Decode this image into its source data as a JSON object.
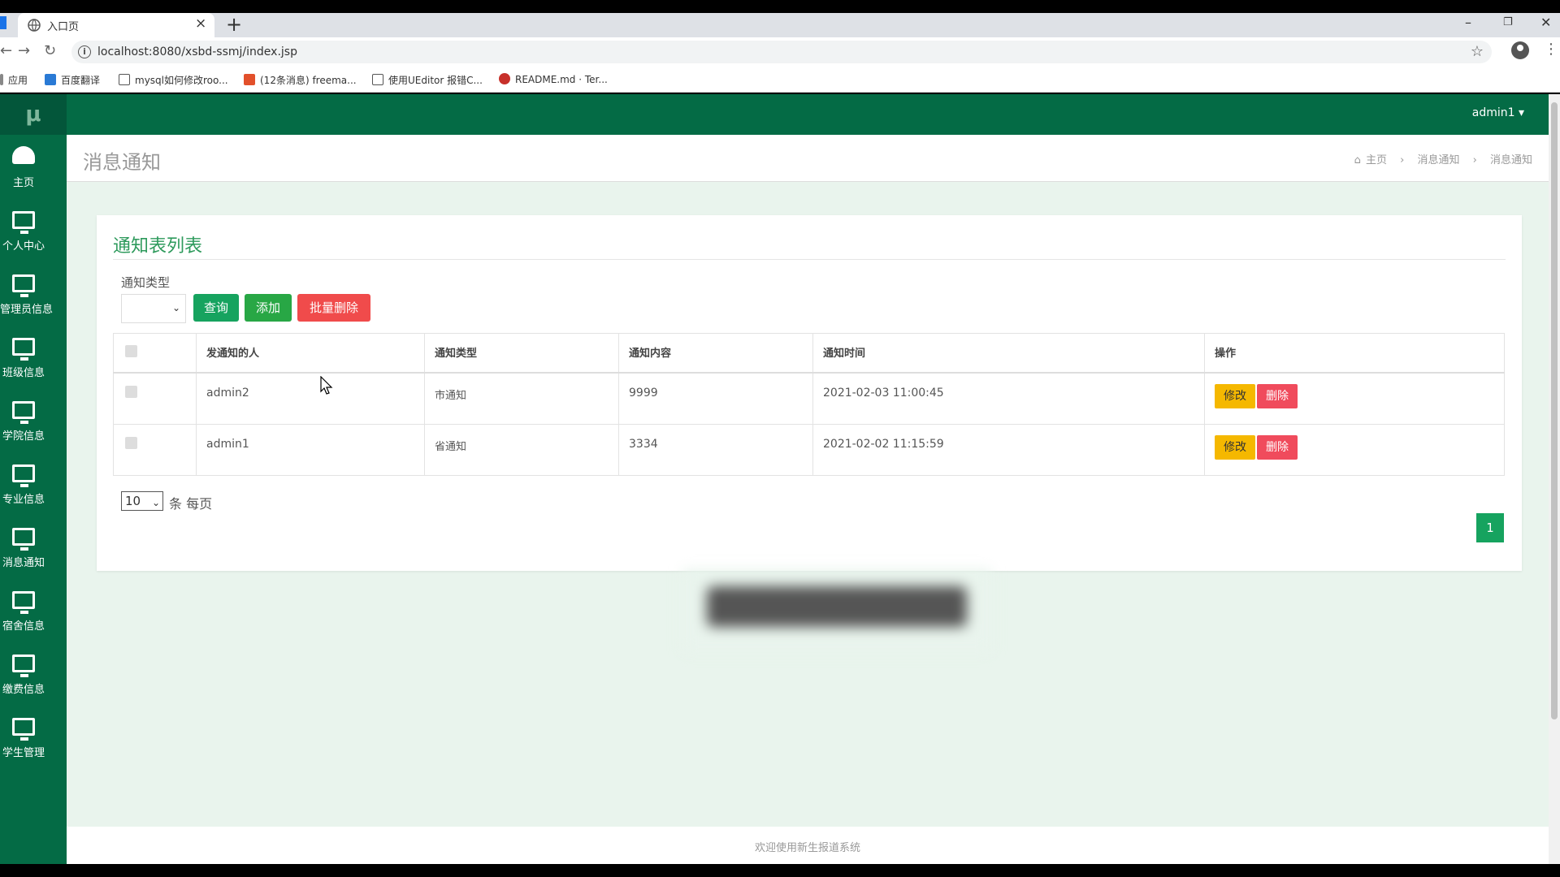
{
  "browser": {
    "tab_title": "入口页",
    "url": "localhost:8080/xsbd-ssmj/index.jsp",
    "bookmarks": [
      {
        "label": "应用",
        "color": "#4285f4"
      },
      {
        "label": "百度翻译",
        "color": "#2a7ad5"
      },
      {
        "label": "mysql如何修改roo...",
        "color": "#555555"
      },
      {
        "label": "(12条消息) freema...",
        "color": "#e2502b"
      },
      {
        "label": "使用UEditor 报错C...",
        "color": "#555555"
      },
      {
        "label": "README.md · Ter...",
        "color": "#c7302a"
      }
    ]
  },
  "app": {
    "logo": "μ",
    "user_menu": "admin1 ▾",
    "colors": {
      "sidebar": "#046b45",
      "accent_green": "#16a35f",
      "danger": "#f04b5c",
      "warning": "#f5b800"
    },
    "sidebar_items": [
      {
        "label": "主页",
        "icon": "dashboard-icon"
      },
      {
        "label": "个人中心",
        "icon": "monitor-icon"
      },
      {
        "label": "管理员信息",
        "icon": "monitor-icon"
      },
      {
        "label": "班级信息",
        "icon": "monitor-icon"
      },
      {
        "label": "学院信息",
        "icon": "monitor-icon"
      },
      {
        "label": "专业信息",
        "icon": "monitor-icon"
      },
      {
        "label": "消息通知",
        "icon": "monitor-icon"
      },
      {
        "label": "宿舍信息",
        "icon": "monitor-icon"
      },
      {
        "label": "缴费信息",
        "icon": "monitor-icon"
      },
      {
        "label": "学生管理",
        "icon": "monitor-icon"
      }
    ],
    "page_title": "消息通知",
    "breadcrumb": {
      "home": "主页",
      "level1": "消息通知",
      "level2": "消息通知"
    },
    "card": {
      "title": "通知表列表",
      "filter_label": "通知类型",
      "filter_value": "",
      "buttons": {
        "query": "查询",
        "add": "添加",
        "batch_delete": "批量删除"
      },
      "columns": [
        "发通知的人",
        "通知类型",
        "通知内容",
        "通知时间",
        "操作"
      ],
      "rows": [
        {
          "sender": "admin2",
          "type": "市通知",
          "content": "9999",
          "time": "2021-02-03 11:00:45"
        },
        {
          "sender": "admin1",
          "type": "省通知",
          "content": "3334",
          "time": "2021-02-02 11:15:59"
        }
      ],
      "row_actions": {
        "edit": "修改",
        "delete": "删除"
      },
      "page_size": "10",
      "page_size_label": "条 每页",
      "current_page": "1"
    },
    "footer": "欢迎使用新生报道系统"
  }
}
